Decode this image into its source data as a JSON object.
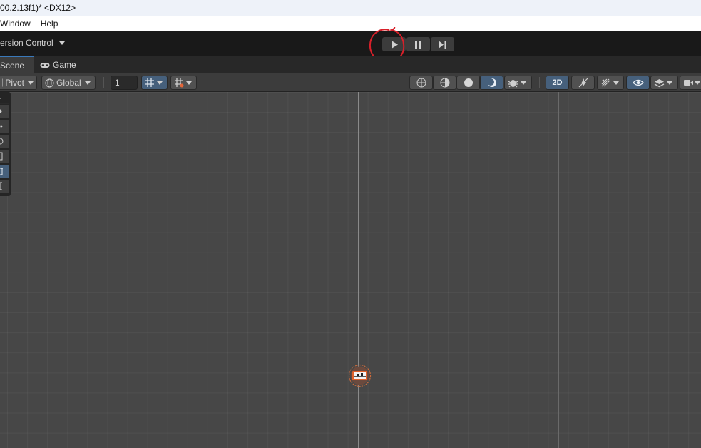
{
  "window": {
    "title": "00.2.13f1)* <DX12>"
  },
  "menu": {
    "items": [
      "Window",
      "Help"
    ]
  },
  "toolbar": {
    "version_control_label": "ersion Control",
    "play_icon": "play-icon",
    "pause_icon": "pause-icon",
    "step_icon": "step-icon",
    "annotation_color": "#d8202a"
  },
  "tabs": {
    "scene_label": "Scene",
    "game_label": "Game"
  },
  "scene_toolbar": {
    "pivot_label": "Pivot",
    "global_label": "Global",
    "grid_size_value": "1",
    "two_d_label": "2D"
  },
  "colors": {
    "accent": "#46607c",
    "tab_highlight": "#3a79bb",
    "viewport_bg": "#474747",
    "toolbar_bg": "#191919",
    "sprite_orange": "#d2691e"
  }
}
